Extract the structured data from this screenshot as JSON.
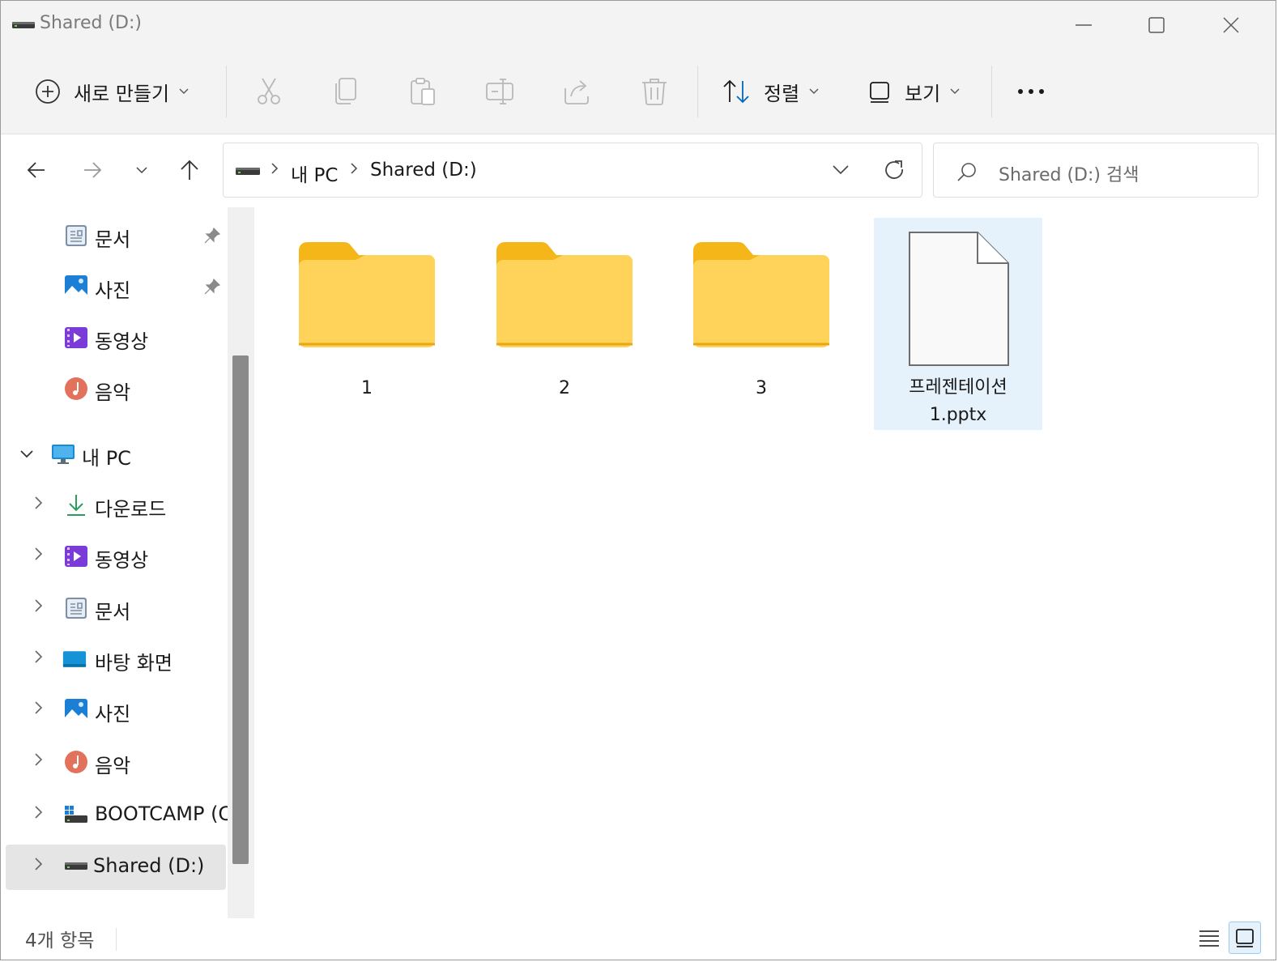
{
  "window": {
    "title": "Shared (D:)"
  },
  "icons": {
    "drive": "drive-icon",
    "minimize": "minimize-icon",
    "maximize": "maximize-icon",
    "close": "close-icon",
    "new": "plus-circle-icon",
    "cut": "scissors-icon",
    "copy": "copy-icon",
    "paste": "paste-icon",
    "rename": "rename-icon",
    "share": "share-icon",
    "delete": "trash-icon",
    "sort": "sort-icon",
    "view": "view-icon",
    "more": "ellipsis-icon"
  },
  "toolbar": {
    "new_label": "새로 만들기",
    "sort_label": "정렬",
    "view_label": "보기"
  },
  "address": {
    "crumbs": [
      "내 PC",
      "Shared (D:)"
    ]
  },
  "search": {
    "placeholder": "Shared (D:) 검색"
  },
  "sidebar": {
    "quick": [
      {
        "label": "문서",
        "icon": "documents-icon",
        "pinned": true
      },
      {
        "label": "사진",
        "icon": "pictures-icon",
        "pinned": true
      },
      {
        "label": "동영상",
        "icon": "videos-icon",
        "pinned": false
      },
      {
        "label": "음악",
        "icon": "music-icon",
        "pinned": false
      }
    ],
    "pc_label": "내 PC",
    "pc_items": [
      {
        "label": "다운로드",
        "icon": "download-icon"
      },
      {
        "label": "동영상",
        "icon": "videos-icon"
      },
      {
        "label": "문서",
        "icon": "documents-icon"
      },
      {
        "label": "바탕 화면",
        "icon": "desktop-icon"
      },
      {
        "label": "사진",
        "icon": "pictures-icon"
      },
      {
        "label": "음악",
        "icon": "music-icon"
      },
      {
        "label": "BOOTCAMP (C:",
        "icon": "windows-drive-icon"
      },
      {
        "label": "Shared (D:)",
        "icon": "drive-icon",
        "selected": true
      }
    ]
  },
  "files": [
    {
      "name": "1",
      "type": "folder"
    },
    {
      "name": "2",
      "type": "folder"
    },
    {
      "name": "3",
      "type": "folder"
    },
    {
      "name_line1": "프레젠테이션",
      "name_line2": "1.pptx",
      "type": "file",
      "selected": true
    }
  ],
  "status": {
    "item_count": "4개 항목"
  },
  "colors": {
    "folder_back": "#f4b619",
    "folder_front": "#ffd35a",
    "selection": "#e5f1fb",
    "accent": "#0067c0"
  }
}
